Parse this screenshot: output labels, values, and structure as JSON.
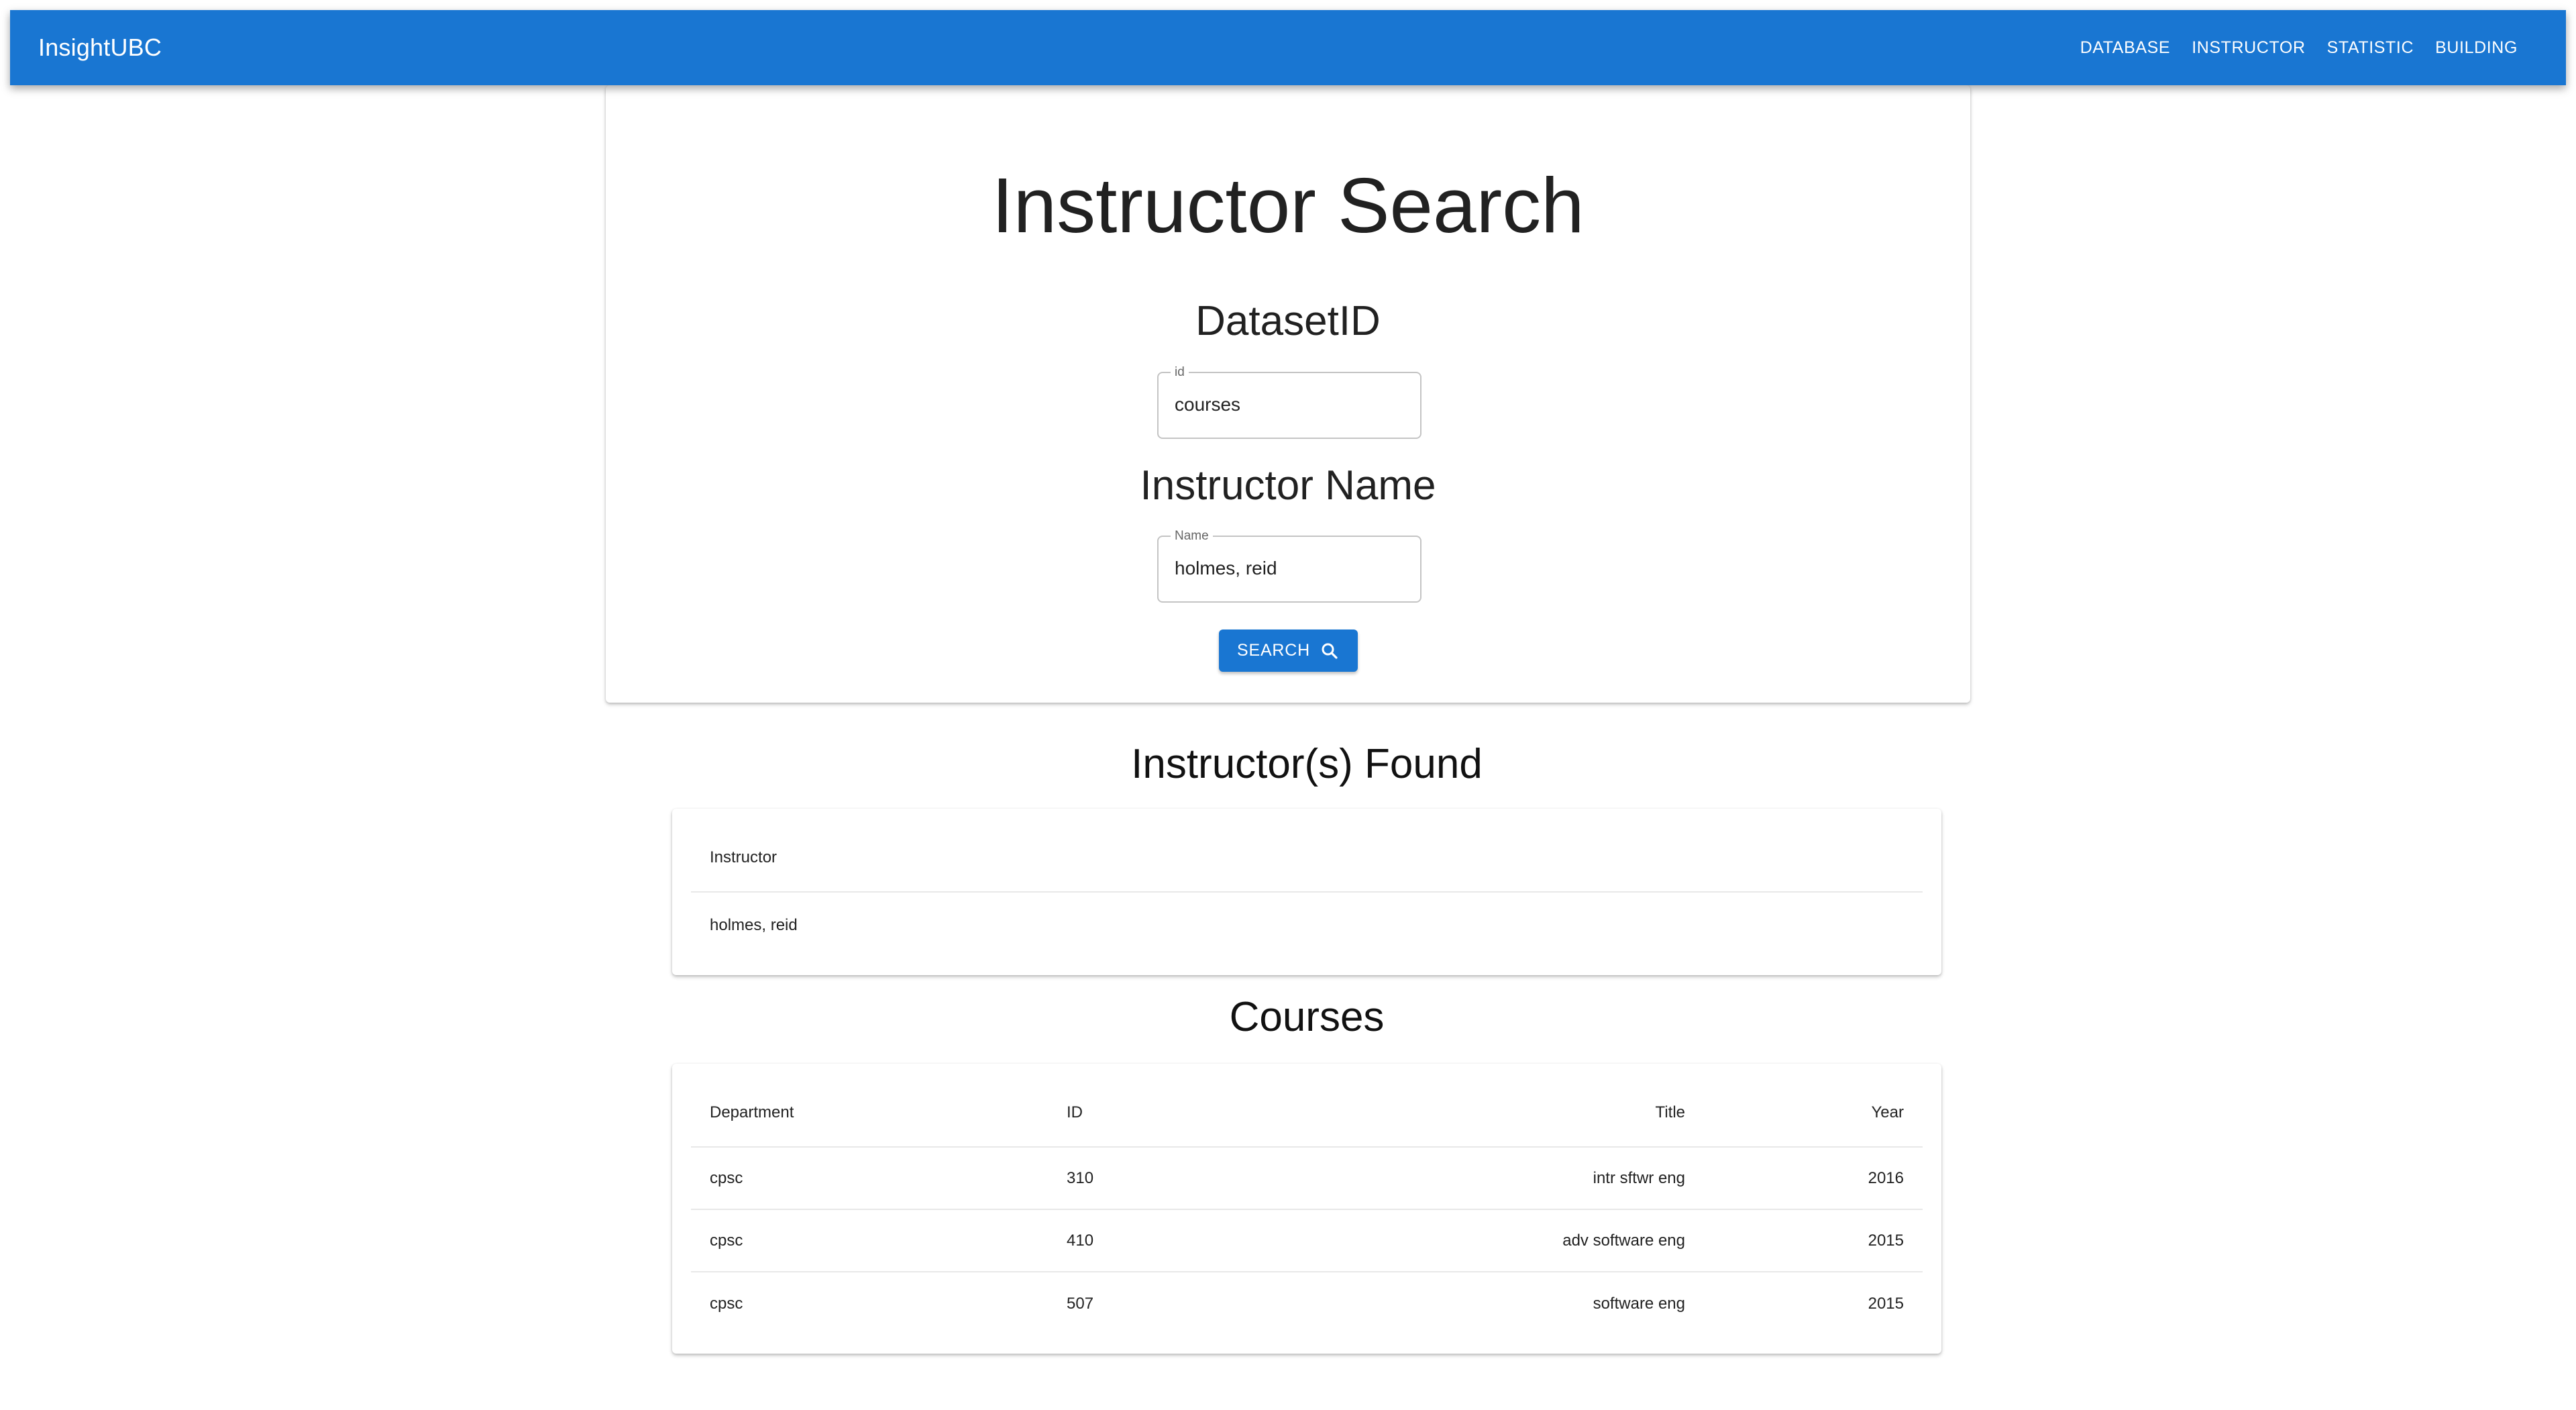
{
  "app": {
    "brand": "InsightUBC",
    "nav": [
      "DATABASE",
      "INSTRUCTOR",
      "STATISTIC",
      "BUILDING"
    ]
  },
  "search": {
    "title": "Instructor Search",
    "dataset_label": "DatasetID",
    "dataset_field": {
      "legend": "id",
      "value": "courses"
    },
    "name_label": "Instructor Name",
    "name_field": {
      "legend": "Name",
      "value": "holmes, reid"
    },
    "button_label": "SEARCH"
  },
  "instructors": {
    "heading": "Instructor(s) Found",
    "column": "Instructor",
    "rows": [
      "holmes, reid"
    ]
  },
  "courses": {
    "heading": "Courses",
    "columns": [
      "Department",
      "ID",
      "Title",
      "Year"
    ],
    "rows": [
      [
        "cpsc",
        "310",
        "intr sftwr eng",
        "2016"
      ],
      [
        "cpsc",
        "410",
        "adv software eng",
        "2015"
      ],
      [
        "cpsc",
        "507",
        "software eng",
        "2015"
      ]
    ]
  },
  "colors": {
    "primary": "#1976d2"
  }
}
